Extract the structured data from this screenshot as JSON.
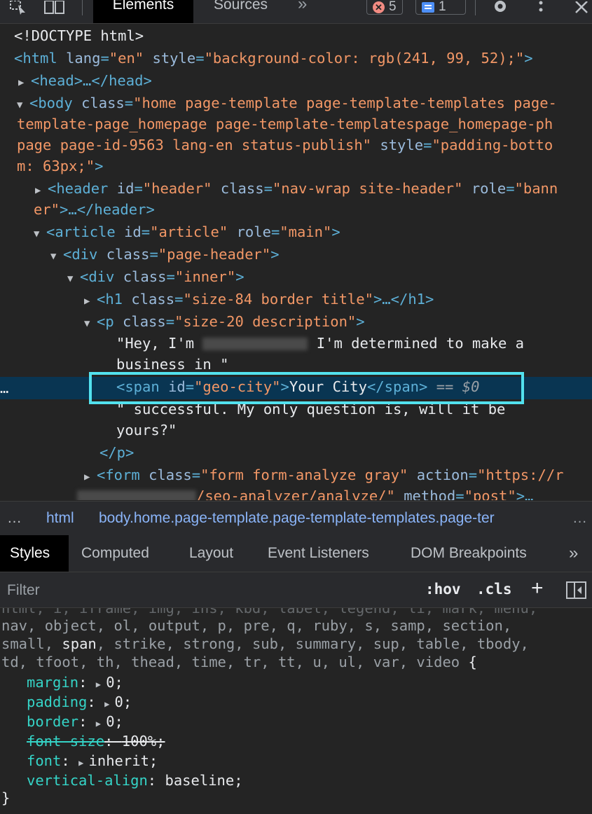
{
  "toolbar": {
    "tab_elements": "Elements",
    "tab_sources": "Sources",
    "more_tabs": "»",
    "errors_count": "5",
    "messages_count": "1"
  },
  "dom_tree": {
    "doctype": "<!DOCTYPE html>",
    "html_tag_open": "<html",
    "html_attr_lang_name": "lang",
    "html_attr_lang_value": "\"en\"",
    "html_attr_style_name": "style",
    "html_attr_style_value": "\"background-color: rgb(241, 99, 52);\"",
    "html_tag_close": ">",
    "head": "<head>…</head>",
    "body_open": "<body",
    "body_class_name": "class",
    "body_class_value_1": "\"home page-template page-template-templates page-",
    "body_class_value_2": "template-page_homepage page-template-templatespage_homepage-ph",
    "body_class_value_3": "page page-id-9563 lang-en status-publish\"",
    "body_style_name": "style",
    "body_style_value_1": "\"padding-botto",
    "body_style_value_2": "m: 63px;\"",
    "header_open": "<header",
    "header_id_name": "id",
    "header_id_value": "\"header\"",
    "header_class_name": "class",
    "header_class_value": "\"nav-wrap site-header\"",
    "header_role_name": "role",
    "header_role_value_1": "\"bann",
    "header_role_value_2": "er\"",
    "header_close": ">…</header>",
    "article_open": "<article",
    "article_id_name": "id",
    "article_id_value": "\"article\"",
    "article_role_name": "role",
    "article_role_value": "\"main\"",
    "div_open": "<div",
    "div_class_name": "class",
    "div_page_header_value": "\"page-header\"",
    "div_inner_value": "\"inner\"",
    "h1_open": "<h1",
    "h1_class_name": "class",
    "h1_class_value": "\"size-84 border title\"",
    "h1_close": ">…</h1>",
    "p_open": "<p",
    "p_class_name": "class",
    "p_class_value": "\"size-20 description\"",
    "text_1a": "\"Hey, I'm ",
    "text_1b": " I'm determined to make a",
    "text_2": "business in \"",
    "span_open": "<span",
    "span_id_name": "id",
    "span_id_value": "\"geo-city\"",
    "span_text": "Your City",
    "span_close": "</span>",
    "span_eq": " == $0",
    "text_3": "\" successful. My only question is, will it be",
    "text_4": "yours?\"",
    "p_close": "</p>",
    "form_open": "<form",
    "form_class_name": "class",
    "form_class_value": "\"form form-analyze gray\"",
    "form_action_name": "action",
    "form_action_value_1": "\"https://r",
    "form_action_value_2": "/seo-analyzer/analyze/\"",
    "form_method_name": "method",
    "form_method_value": "\"post\"",
    "form_tail": ">…",
    "row_dots": "…"
  },
  "breadcrumb": {
    "dots_left": "…",
    "item_html": "html",
    "item_body": "body.home.page-template.page-template-templates.page-ter",
    "dots_right": "…"
  },
  "subtabs": {
    "styles": "Styles",
    "computed": "Computed",
    "layout": "Layout",
    "event_listeners": "Event Listeners",
    "dom_breakpoints": "DOM Breakpoints",
    "more": "»"
  },
  "filter": {
    "placeholder": "Filter",
    "hov": ":hov",
    "cls": ".cls",
    "add": "+"
  },
  "styles_pane": {
    "selector_line_0": "html, i, iframe, img, ins, kbd, label, legend, li, mark, menu,",
    "selector_line_1": "nav, object, ol, output, p, pre, q, ruby, s, samp, section,",
    "selector_line_2a": "small, ",
    "selector_line_2b": "span",
    "selector_line_2c": ", strike, strong, sub, summary, sup, table, tbody,",
    "selector_line_3": "td, tfoot, th, thead, time, tr, tt, u, ul, var, video ",
    "open_brace": "{",
    "close_brace": "}",
    "properties": [
      {
        "name": "margin",
        "value": "0;",
        "expandable": true,
        "strike": false
      },
      {
        "name": "padding",
        "value": "0;",
        "expandable": true,
        "strike": false
      },
      {
        "name": "border",
        "value": "0;",
        "expandable": true,
        "strike": false
      },
      {
        "name": "font-size",
        "value": "100%;",
        "expandable": false,
        "strike": true
      },
      {
        "name": "font",
        "value": "inherit;",
        "expandable": true,
        "strike": false
      },
      {
        "name": "vertical-align",
        "value": "baseline;",
        "expandable": false,
        "strike": false
      }
    ]
  },
  "colors": {
    "selection_outline": "#52e1ee",
    "selected_row": "#093552",
    "tag": "#5db0d7",
    "attr_value": "#f29766",
    "css_property": "#35d4c7"
  }
}
